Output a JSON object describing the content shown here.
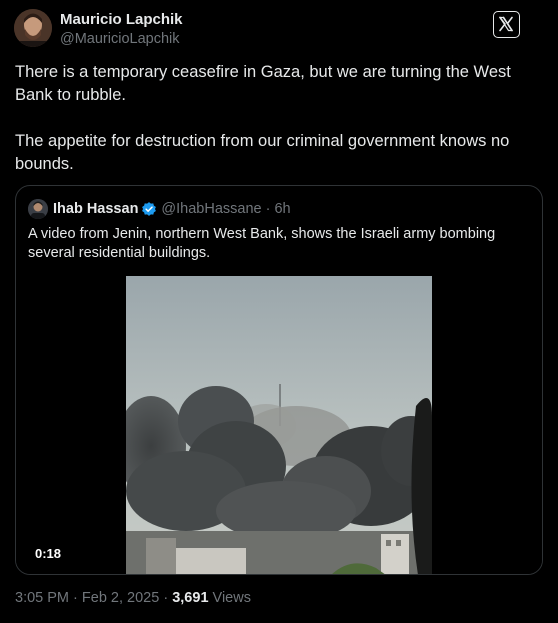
{
  "author": {
    "name": "Mauricio Lapchik",
    "handle": "@MauricioLapchik"
  },
  "tweet": {
    "paragraphs": [
      "There is a temporary ceasefire in Gaza, but we are turning the West Bank to rubble.",
      "The appetite for destruction from our criminal government knows no bounds."
    ]
  },
  "quoted": {
    "name": "Ihab Hassan",
    "handle": "@IhabHassane",
    "separator": "·",
    "time": "6h",
    "text": "A video from Jenin, northern West Bank, shows the Israeli army bombing several residential buildings.",
    "video_duration": "0:18"
  },
  "meta": {
    "time": "3:05 PM",
    "separator": "·",
    "date": "Feb 2, 2025",
    "separator2": "·",
    "views_count": "3,691",
    "views_label": "Views"
  },
  "icons": {
    "logo": "x-logo-icon",
    "verified": "verified-badge-icon"
  },
  "colors": {
    "background": "#000000",
    "text": "#e7e9ea",
    "muted": "#71767b",
    "border": "#2f3336",
    "verified": "#1d9bf0"
  }
}
